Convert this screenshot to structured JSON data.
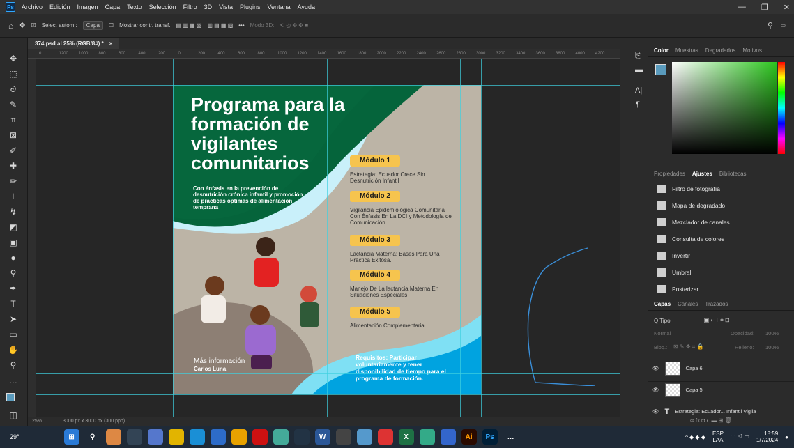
{
  "menubar": {
    "app_icon": "Ps",
    "items": [
      "Archivo",
      "Edición",
      "Imagen",
      "Capa",
      "Texto",
      "Selección",
      "Filtro",
      "3D",
      "Vista",
      "Plugins",
      "Ventana",
      "Ayuda"
    ]
  },
  "options": {
    "auto_select": "Selec. autom.:",
    "layer_select": "Capa",
    "transform": "Mostrar contr. transf.",
    "mode3d": "Modo 3D:"
  },
  "document": {
    "tab_title": "374.psd al 25% (RGB/8#) *",
    "zoom": "25%",
    "size_info": "3000 px x 3000 px (300 ppp)"
  },
  "ruler_ticks": [
    "0",
    "1200",
    "1000",
    "800",
    "600",
    "400",
    "200",
    "0",
    "200",
    "400",
    "600",
    "800",
    "1000",
    "1200",
    "1400",
    "1600",
    "1800",
    "2000",
    "2200",
    "2400",
    "2600",
    "2800",
    "3000",
    "3200",
    "3400",
    "3600",
    "3800",
    "4000",
    "4200"
  ],
  "flyer": {
    "title": "Programa para la formación de vigilantes comunitarios",
    "subtitle": "Con énfasis en la prevención de desnutrición crónica infantil y promoción de prácticas optimas de alimentación temprana",
    "modules": [
      {
        "label": "Módulo 1",
        "desc": "Estrategia: Ecuador Crece Sin Desnutrición Infantil"
      },
      {
        "label": "Módulo 2",
        "desc": "Vigilancia Epidemiológica Comunitaria Con Énfasis En La DCI y Metodología de Comunicación."
      },
      {
        "label": "Módulo 3",
        "desc": "Lactancia Materna: Bases Para Una Práctica Exitosa."
      },
      {
        "label": "Módulo 4",
        "desc": "Manejo De La lactancia Materna En Situaciones Especiales"
      },
      {
        "label": "Módulo 5",
        "desc": "Alimentación Complementaria"
      }
    ],
    "more_info": "Más información",
    "contact": "Carlos Luna",
    "requirements": "Requisitos: Participar voluntariamente y tener disponibilidad de tiempo para el programa de formación."
  },
  "color_panel": {
    "tabs": [
      "Color",
      "Muestras",
      "Degradados",
      "Motivos"
    ],
    "active": "Color",
    "fg_color": "#5a9bbd"
  },
  "adjust_panel": {
    "tabs": [
      "Propiedades",
      "Ajustes",
      "Bibliotecas"
    ],
    "active": "Ajustes",
    "items": [
      "Filtro de fotografía",
      "Mapa de degradado",
      "Mezclador de canales",
      "Consulta de colores",
      "Invertir",
      "Umbral",
      "Posterizar"
    ]
  },
  "layers_panel": {
    "tabs": [
      "Capas",
      "Canales",
      "Trazados"
    ],
    "active": "Capas",
    "filter": "Q Tipo",
    "blend": "Normal",
    "opacity_label": "Opacidad:",
    "opacity": "100%",
    "lock_label": "Bloq.:",
    "fill_label": "Relleno:",
    "fill": "100%",
    "layers": [
      {
        "name": "Capa 6"
      },
      {
        "name": "Capa 5"
      },
      {
        "name": "Estrategia: Ecuador... Infantil Vigila"
      }
    ]
  },
  "taskbar": {
    "weather": "29°",
    "lang1": "ESP",
    "lang2": "LAA",
    "time": "18:59",
    "date": "1/7/2024"
  }
}
